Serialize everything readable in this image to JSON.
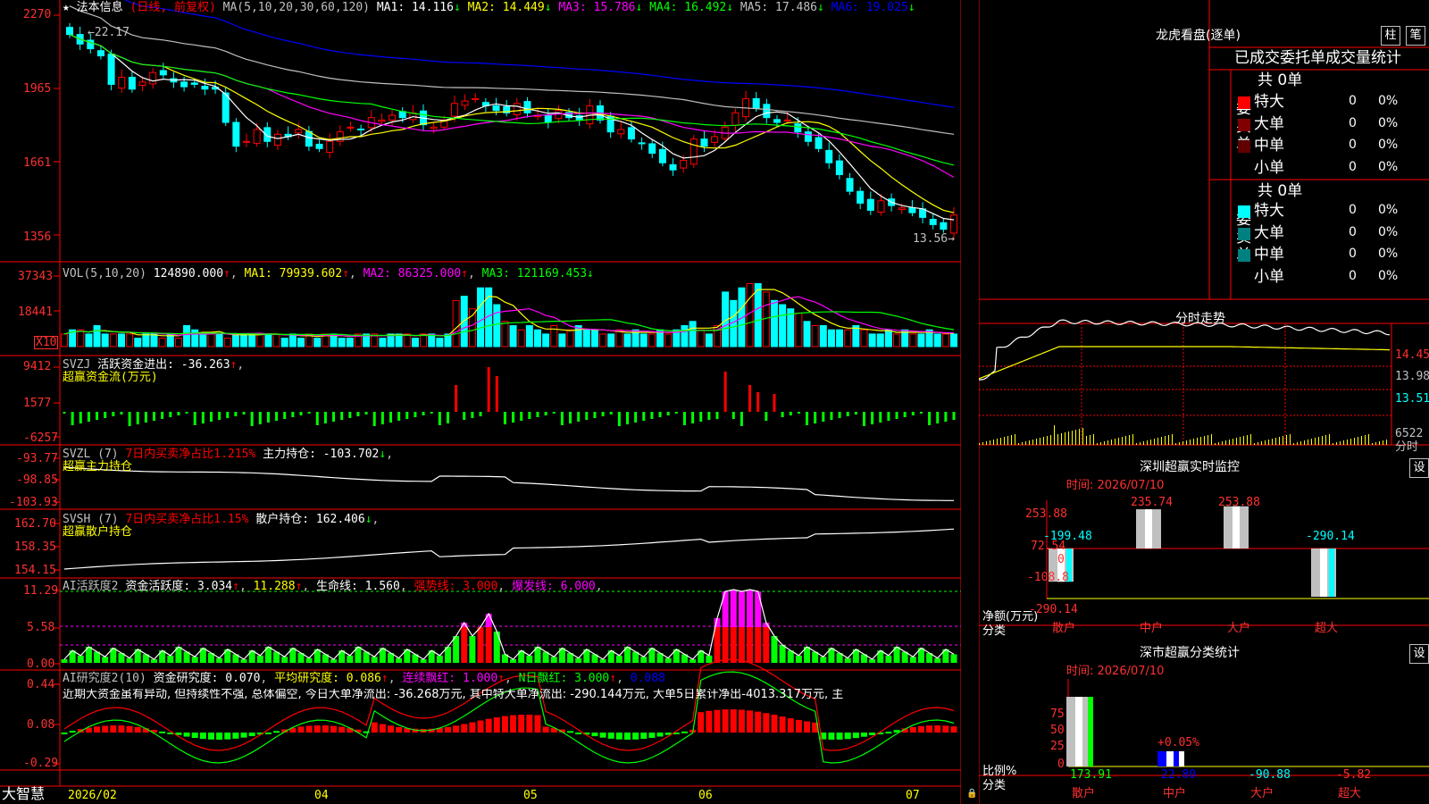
{
  "app": {
    "name": "大智慧"
  },
  "kline": {
    "star": "★",
    "stock_name": "法本信息",
    "period": "(日线, 前复权)",
    "ma_params": "MA(5,10,20,30,60,120)",
    "ma": [
      {
        "label": "MA1:",
        "value": "14.116",
        "color": "#ffffff"
      },
      {
        "label": "MA2:",
        "value": "14.449",
        "color": "#ffff00"
      },
      {
        "label": "MA3:",
        "value": "15.786",
        "color": "#ff00ff"
      },
      {
        "label": "MA4:",
        "value": "16.492",
        "color": "#00ff00"
      },
      {
        "label": "MA5:",
        "value": "17.486",
        "color": "#c0c0c0"
      },
      {
        "label": "MA6:",
        "value": "19.025",
        "color": "#0000ff"
      }
    ],
    "y_ticks": [
      "2270",
      "1965",
      "1661",
      "1356"
    ],
    "high_label": "22.17",
    "low_label": "13.56",
    "closes": [
      21.9,
      21.5,
      21.3,
      21.0,
      19.8,
      20.1,
      19.6,
      19.9,
      20.3,
      20.2,
      19.9,
      19.7,
      19.8,
      19.6,
      19.6,
      18.2,
      17.2,
      17.4,
      17.9,
      17.4,
      17.7,
      17.6,
      17.9,
      17.2,
      17.1,
      17.4,
      17.8,
      18.0,
      17.9,
      18.4,
      18.3,
      18.5,
      18.4,
      18.6,
      18.1,
      18.0,
      18.3,
      19.0,
      19.1,
      19.2,
      18.9,
      18.7,
      18.6,
      19.0,
      18.6,
      18.5,
      18.2,
      18.7,
      18.4,
      18.3,
      18.9,
      18.3,
      17.8,
      17.9,
      17.5,
      17.3,
      16.9,
      16.5,
      16.2,
      16.6,
      17.5,
      17.2,
      17.6,
      18.0,
      18.6,
      19.2,
      18.8,
      18.4,
      18.2,
      18.3,
      17.8,
      17.4,
      17.1,
      16.5,
      16.0,
      15.3,
      14.8,
      14.5,
      14.9,
      14.7,
      14.6,
      14.4,
      14.2,
      13.9,
      13.7,
      14.3
    ]
  },
  "vol": {
    "params": "VOL(5,10,20)",
    "value": "124890.000",
    "ma1": "MA1: 79939.602",
    "ma2": "MA2: 86325.000",
    "ma3": "MA3: 121169.453",
    "y_ticks": [
      "37343",
      "18441"
    ],
    "unit": "X10",
    "bars": [
      3,
      4,
      4,
      3,
      5,
      3,
      3,
      3,
      3,
      2,
      3,
      3,
      2,
      3,
      2,
      5,
      4,
      3,
      3,
      3,
      2,
      3,
      3,
      3,
      3,
      3,
      3,
      2,
      3,
      2,
      3,
      2,
      3,
      3,
      2,
      2,
      3,
      3,
      3,
      2,
      3,
      3,
      3,
      2,
      3,
      3,
      2,
      3,
      11,
      12,
      9,
      14,
      14,
      10,
      6,
      5,
      4,
      5,
      4,
      3,
      5,
      3,
      4,
      5,
      4,
      4,
      3,
      3,
      4,
      3,
      4,
      3,
      3,
      4,
      3,
      4,
      5,
      6,
      4,
      3,
      5,
      13,
      11,
      14,
      15,
      15,
      13,
      11,
      10,
      9,
      8,
      6,
      5,
      5,
      4,
      4,
      4,
      5,
      4,
      3,
      3,
      4,
      3,
      4,
      3,
      3,
      4,
      3,
      3,
      3
    ]
  },
  "svzj": {
    "name": "SVZJ",
    "label": "活跃资金进出:",
    "value": "-36.263",
    "sub": "超赢资金流(万元)",
    "y_ticks": [
      "9412",
      "1577",
      "-6257"
    ]
  },
  "svzl": {
    "name": "SVZL (7)",
    "ratio": "7日内买卖净占比1.215%",
    "label": "主力持仓:",
    "value": "-103.702",
    "sub": "超赢主力持仓",
    "y_ticks": [
      "-93.77",
      "-98.85",
      "-103.93"
    ]
  },
  "svsh": {
    "name": "SVSH (7)",
    "ratio": "7日内买卖净占比1.15%",
    "label": "散户持仓:",
    "value": "162.406",
    "sub": "超赢散户持仓",
    "y_ticks": [
      "162.70",
      "158.35",
      "154.15"
    ]
  },
  "ai_active": {
    "name": "AI活跃度2",
    "label": "资金活跃度:",
    "value": "3.034",
    "v2": "11.288",
    "life_label": "生命线:",
    "life_value": "1.560",
    "strong": "强势线: 3.000",
    "burst": "爆发线: 6.000",
    "y_ticks": [
      "11.29",
      "5.58",
      "0.00"
    ]
  },
  "ai_research": {
    "name": "AI研究度2(10)",
    "label": "资金研究度:",
    "value": "0.070",
    "avg": "平均研究度: 0.086",
    "red": "连续飘红: 1.000",
    "nday": "N日飘红: 3.000",
    "last": "0.088",
    "comment": "近期大资金虽有异动, 但持续性不强, 总体偏空, 今日大单净流出: -36.268万元, 其中特大单净流出: -290.144万元, 大单5日累计净出-4013.317万元, 主",
    "y_ticks": [
      "0.44",
      "0.08",
      "-0.29"
    ]
  },
  "time_axis": [
    "2026/02",
    "04",
    "05",
    "06",
    "07"
  ],
  "dragon": {
    "title": "龙虎看盘(逐单)",
    "btn_bar": "柱",
    "btn_pen": "笔",
    "tabs": "已成交委托单成交量统计",
    "buy_label": "委买单",
    "sell_label": "委卖单",
    "buy_total": "共 0单",
    "sell_total": "共 0单",
    "buy_rows": [
      {
        "name": "特大",
        "val": "0",
        "pct": "0%",
        "color": "#ff0000"
      },
      {
        "name": "大单",
        "val": "0",
        "pct": "0%",
        "color": "#800000"
      },
      {
        "name": "中单",
        "val": "0",
        "pct": "0%",
        "color": "#600000"
      },
      {
        "name": "小单",
        "val": "0",
        "pct": "0%",
        "color": "#000000"
      }
    ],
    "sell_rows": [
      {
        "name": "特大",
        "val": "0",
        "pct": "0%",
        "color": "#00ffff"
      },
      {
        "name": "大单",
        "val": "0",
        "pct": "0%",
        "color": "#008080"
      },
      {
        "name": "中单",
        "val": "0",
        "pct": "0%",
        "color": "#008080"
      },
      {
        "name": "小单",
        "val": "0",
        "pct": "0%",
        "color": "#000000"
      }
    ]
  },
  "intraday": {
    "title": "分时走势",
    "y_ticks": [
      "14.45",
      "13.98",
      "13.51"
    ],
    "vol_tick": "6522",
    "vol_label": "分时"
  },
  "sz_monitor": {
    "title": "深圳超赢实时监控",
    "btn": "设",
    "time": "时间: 2026/07/10",
    "y_ticks": [
      "253.88",
      "72.54",
      "0",
      "-108.8",
      "-290.14"
    ],
    "ylabel": "净额(万元)",
    "xlabel": "分类",
    "categories": [
      "散户",
      "中户",
      "大户",
      "超大"
    ],
    "values": [
      -199.48,
      235.74,
      253.88,
      -290.14
    ],
    "value_labels": [
      "-199.48",
      "235.74",
      "253.88",
      "-290.14"
    ]
  },
  "sz_class": {
    "title": "深市超赢分类统计",
    "btn": "设",
    "time": "时间: 2026/07/10",
    "y_ticks": [
      "75",
      "50",
      "25",
      "0"
    ],
    "ylabel": "比例%",
    "xlabel": "分类",
    "categories": [
      "散户",
      "中户",
      "大户",
      "超大"
    ],
    "values": [
      173.91,
      22.8,
      -90.88,
      -5.82
    ],
    "value_labels": [
      "173.91",
      "22.80",
      "-90.88",
      "-5.82"
    ],
    "pct_note": "+0.05%"
  }
}
